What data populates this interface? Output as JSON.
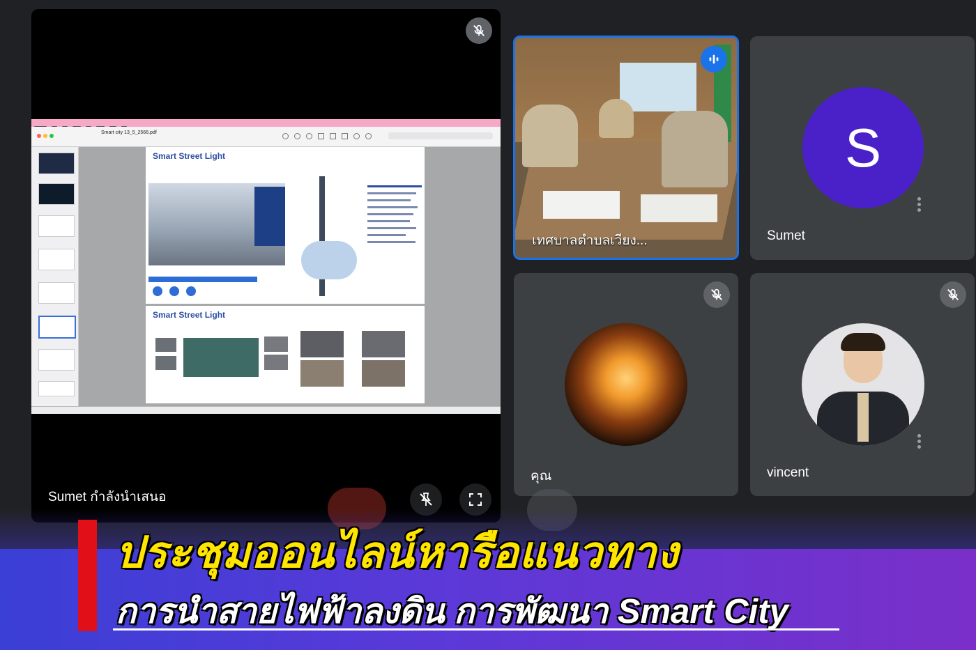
{
  "presenter": {
    "name_label": "Sumet กำลังนำเสนอ",
    "pdf": {
      "filename": "Smart city 13_5_2566.pdf",
      "slide_title_1": "Smart Street Light",
      "slide_title_2": "Smart Street Light"
    }
  },
  "participants": [
    {
      "name": "เทศบาลตำบลเวียง...",
      "state": "speaking"
    },
    {
      "name": "Sumet",
      "avatar_letter": "S",
      "avatar_color": "#4a21c9"
    },
    {
      "name": "คุณ",
      "muted": true
    },
    {
      "name": "vincent",
      "muted": true
    }
  ],
  "caption": {
    "line1": "ประชุมออนไลน์หารือแนวทาง",
    "line2": "การนำสายไฟฟ้าลงดิน การพัฒนา Smart City"
  },
  "icons": {
    "mic_off": "mic-off-icon",
    "speaking": "audio-wave-icon",
    "pin": "pin-off-icon",
    "fullscreen": "fullscreen-icon",
    "more": "more-vert-icon"
  },
  "colors": {
    "background": "#202124",
    "tile": "#3c4043",
    "active_border": "#1a73e8",
    "caption_yellow": "#ffe500",
    "caption_red": "#e10f17"
  }
}
